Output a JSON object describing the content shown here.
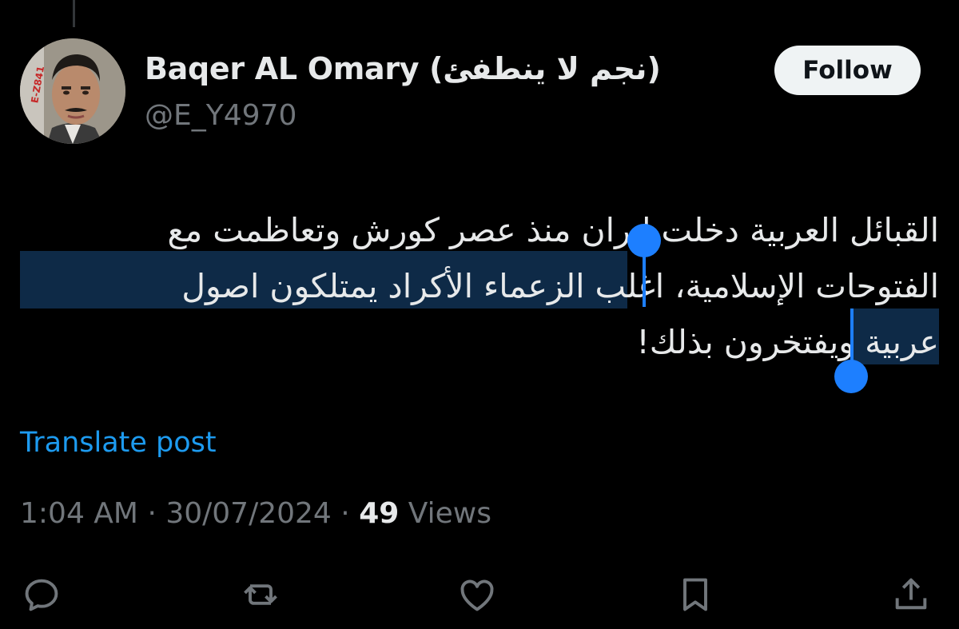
{
  "author": {
    "display_name": "Baqer AL Omary (نجم لا ينطفئ)",
    "handle": "@E_Y4970",
    "avatar_badge": "E-Z841"
  },
  "follow_button": {
    "label": "Follow"
  },
  "tweet": {
    "lines": [
      "القبائل العربية دخلت ايران منذ عصر كورش وتعاظمت مع",
      "الفتوحات الإسلامية، اغلب الزعماء الأكراد يمتلكون اصول",
      "عربية ويفتخرون بذلك!"
    ]
  },
  "translate": {
    "label": "Translate post"
  },
  "meta": {
    "time": "1:04 AM",
    "separator": "·",
    "date": "30/07/2024",
    "views_count": "49",
    "views_label": "Views"
  },
  "actions": [
    {
      "icon": "reply-icon"
    },
    {
      "icon": "repost-icon"
    },
    {
      "icon": "like-icon"
    },
    {
      "icon": "bookmark-icon"
    },
    {
      "icon": "share-icon"
    }
  ],
  "colors": {
    "background": "#000000",
    "text_primary": "#e7e9ea",
    "text_secondary": "#71767b",
    "link": "#1d9bf0",
    "selection": "#0e2a47",
    "selection_handle": "#1d7fff",
    "follow_bg": "#eff3f4"
  }
}
